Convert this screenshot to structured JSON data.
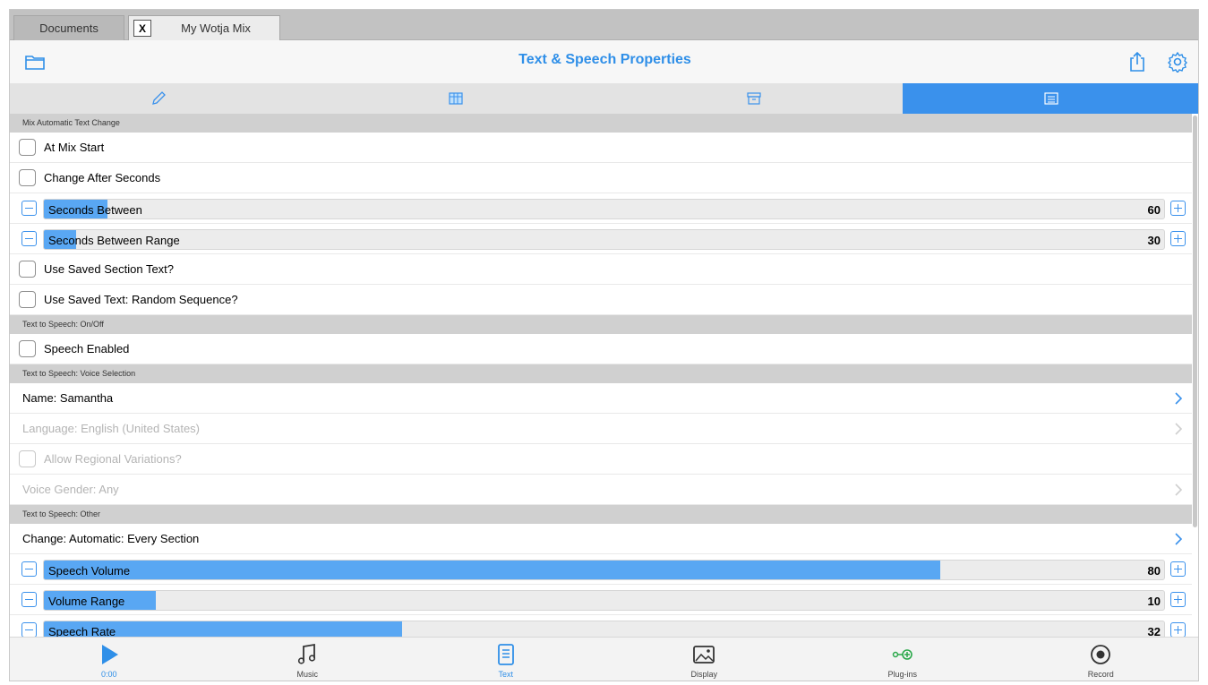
{
  "doc_tabs": {
    "inactive_label": "Documents",
    "close_label": "X",
    "active_label": "My Wotja Mix"
  },
  "navbar": {
    "title": "Text & Speech Properties"
  },
  "segments": [
    "pencil-icon",
    "grid-icon",
    "archive-icon",
    "list-icon"
  ],
  "sections": {
    "mix_auto": "Mix Automatic Text Change",
    "speech_onoff": "Text to Speech: On/Off",
    "voice_selection": "Text to Speech: Voice Selection",
    "other": "Text to Speech: Other"
  },
  "rows": {
    "at_mix_start": "At Mix Start",
    "change_after_seconds": "Change After Seconds",
    "use_saved_section_text": "Use Saved Section Text?",
    "use_saved_random": "Use Saved Text: Random Sequence?",
    "speech_enabled": "Speech Enabled",
    "name": "Name: Samantha",
    "language": "Language: English (United States)",
    "allow_regional": "Allow Regional Variations?",
    "voice_gender": "Voice Gender: Any",
    "change_auto": "Change: Automatic: Every Section"
  },
  "sliders": {
    "seconds_between": {
      "label": "Seconds Between",
      "value": "60",
      "fill": 0.057
    },
    "seconds_between_range": {
      "label": "Seconds Between Range",
      "value": "30",
      "fill": 0.029
    },
    "speech_volume": {
      "label": "Speech Volume",
      "value": "80",
      "fill": 0.8
    },
    "volume_range": {
      "label": "Volume Range",
      "value": "10",
      "fill": 0.1
    },
    "speech_rate": {
      "label": "Speech Rate",
      "value": "32",
      "fill": 0.32
    }
  },
  "tabbar": {
    "play": "0:00",
    "music": "Music",
    "text": "Text",
    "display": "Display",
    "plugins": "Plug-ins",
    "record": "Record"
  },
  "colors": {
    "accent": "#3a91ec",
    "slider_fill": "#59a7f3",
    "plugins_green": "#2aa84a"
  }
}
